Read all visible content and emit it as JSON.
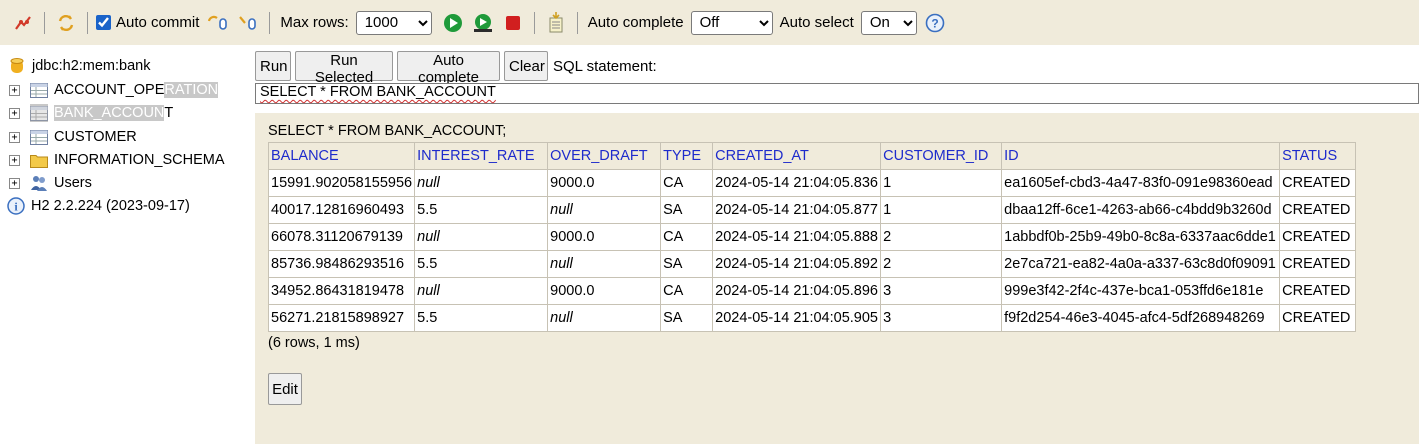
{
  "toolbar": {
    "auto_commit_label": "Auto commit",
    "auto_commit_checked": true,
    "max_rows_label": "Max rows:",
    "max_rows_value": "1000",
    "auto_complete_label": "Auto complete",
    "auto_complete_value": "Off",
    "auto_select_label": "Auto select",
    "auto_select_value": "On",
    "icons": [
      "disconnect-icon",
      "refresh-icon",
      "commit-icon",
      "rollback-icon",
      "run-icon",
      "run-selected-icon",
      "stop-icon",
      "history-icon",
      "help-icon"
    ]
  },
  "tree": {
    "connection": "jdbc:h2:mem:bank",
    "tables": [
      {
        "name_a": "ACCOUNT_OPE",
        "name_b": "RATION"
      },
      {
        "name_a": "BANK_ACCOUN",
        "name_b": "T"
      },
      {
        "name": "CUSTOMER"
      }
    ],
    "schema": "INFORMATION_SCHEMA",
    "users": "Users",
    "version": "H2 2.2.224 (2023-09-17)"
  },
  "query": {
    "run_label": "Run",
    "run_selected_label": "Run Selected",
    "auto_complete_label": "Auto complete",
    "clear_label": "Clear",
    "sql_statement_label": "SQL statement:",
    "sql_text": "SELECT * FROM BANK_ACCOUNT"
  },
  "result": {
    "statement": "SELECT * FROM BANK_ACCOUNT;",
    "columns": [
      "BALANCE",
      "INTEREST_RATE",
      "OVER_DRAFT",
      "TYPE",
      "CREATED_AT",
      "CUSTOMER_ID",
      "ID",
      "STATUS"
    ],
    "rows": [
      [
        "15991.902058155956",
        "null",
        "9000.0",
        "CA",
        "2024-05-14 21:04:05.836",
        "1",
        "ea1605ef-cbd3-4a47-83f0-091e98360ead",
        "CREATED"
      ],
      [
        "40017.12816960493",
        "5.5",
        "null",
        "SA",
        "2024-05-14 21:04:05.877",
        "1",
        "dbaa12ff-6ce1-4263-ab66-c4bdd9b3260d",
        "CREATED"
      ],
      [
        "66078.31120679139",
        "null",
        "9000.0",
        "CA",
        "2024-05-14 21:04:05.888",
        "2",
        "1abbdf0b-25b9-49b0-8c8a-6337aac6dde1",
        "CREATED"
      ],
      [
        "85736.98486293516",
        "5.5",
        "null",
        "SA",
        "2024-05-14 21:04:05.892",
        "2",
        "2e7ca721-ea82-4a0a-a337-63c8d0f09091",
        "CREATED"
      ],
      [
        "34952.86431819478",
        "null",
        "9000.0",
        "CA",
        "2024-05-14 21:04:05.896",
        "3",
        "999e3f42-2f4c-437e-bca1-053ffd6e181e",
        "CREATED"
      ],
      [
        "56271.21815898927",
        "5.5",
        "null",
        "SA",
        "2024-05-14 21:04:05.905",
        "3",
        "f9f2d254-46e3-4045-afc4-5df268948269",
        "CREATED"
      ]
    ],
    "summary": "(6 rows, 1 ms)",
    "edit_label": "Edit"
  },
  "colors": {
    "panel_bg": "#f0ebdb",
    "header_text": "#1e2bcc",
    "selection": "#c8c8c8"
  }
}
